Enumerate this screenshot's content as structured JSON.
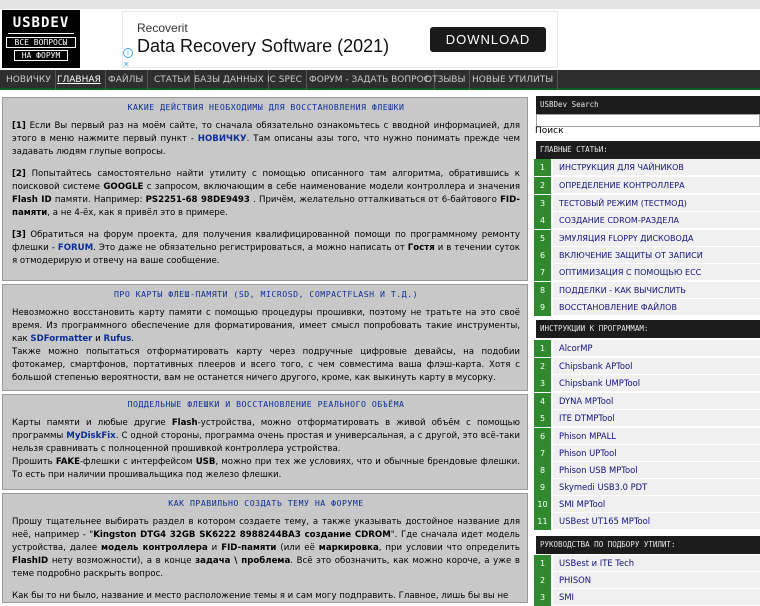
{
  "logo": {
    "line1": "USBDEV",
    "line2": "ВСЕ ВОПРОСЫ",
    "line3": "НА ФОРУМ"
  },
  "ad": {
    "brand": "Recoverit",
    "headline": "Data Recovery Software (2021)",
    "button": "DOWNLOAD",
    "info_icon": "info-icon",
    "close_icon": "close-icon"
  },
  "nav": [
    "НОВИЧКУ",
    "ГЛАВНАЯ",
    "ФАЙЛЫ",
    "СТАТЬИ",
    "БАЗЫ ДАННЫХ",
    "IC SPEC",
    "ФОРУМ - ЗАДАТЬ ВОПРОС",
    "ОТЗЫВЫ",
    "НОВЫЕ УТИЛИТЫ"
  ],
  "sections": [
    {
      "title": "КАКИЕ ДЕЙСТВИЯ НЕОБХОДИМЫ ДЛЯ ВОССТАНОВЛЕНИЯ ФЛЕШКИ",
      "p1a": "[1]",
      "p1b": " Если Вы первый раз на моём сайте, то сначала обязательно ознакомьтесь с вводной информацией, для этого в меню нажмите первый пункт - ",
      "p1c": "НОВИЧКУ",
      "p1d": ". Там описаны азы того, что нужно понимать прежде чем задавать людям глупые вопросы.",
      "p2a": "[2]",
      "p2b": " Попытайтесь самостоятельно найти утилиту с помощью описанного там алгоритма, обратившись к поисковой системе ",
      "p2c": "GOOGLE",
      "p2d": " с запросом, включающим в себе наименование модели контроллера и значения ",
      "p2e": "Flash ID",
      "p2f": " памяти. Например: ",
      "p2g": "PS2251-68 98DE9493",
      "p2h": " . Причём, желательно отталкиваться от 6-байтового ",
      "p2i": "FID-памяти",
      "p2j": ", а не 4-ёх, как я привёл это в примере.",
      "p3a": "[3]",
      "p3b": " Обратиться на форум проекта, для получения квалифицированной помощи по программному ремонту флешки - ",
      "p3c": "FORUM",
      "p3d": ". Это даже не обязательно регистрироваться, а можно написать от ",
      "p3e": "Гостя",
      "p3f": " и в течении суток я отмодерирую и отвечу на ваше сообщение."
    },
    {
      "title": "ПРО КАРТЫ ФЛЕШ-ПАМЯТИ (SD, microSD, CompactFlash и т.д.)",
      "p1a": "Невозможно восстановить карту памяти с помощью процедуры прошивки, поэтому не тратьте на это своё время. Из программного обеспечение для форматирования, имеет смысл попробовать такие инструменты, как ",
      "p1b": "SDFormatter",
      "p1c": " и ",
      "p1d": "Rufus",
      "p1e": ".",
      "p2": "Также можно попытаться отформатировать карту через подручные цифровые девайсы, на подобии фотокамер, смартфонов, портативных плееров и всего того, с чем совместима ваша флэш-карта. Хотя с большой степенью вероятности, вам не останется ничего другого, кроме, как выкинуть карту в мусорку."
    },
    {
      "title": "ПОДДЕЛЬНЫЕ ФЛЕШКИ И ВОССТАНОВЛЕНИЕ РЕАЛЬНОГО ОБЪЁМА",
      "p1a": "Карты памяти и любые другие ",
      "p1b": "Flash",
      "p1c": "-устройства, можно отформатировать в живой объём с помощью программы ",
      "p1d": "MyDiskFix",
      "p1e": ". С одной стороны, программа очень простая и универсальная, а с другой, это всё-таки нельзя сравнивать с полноценной прошивкой контроллера устройства.",
      "p2a": "Прошить ",
      "p2b": "FAKE",
      "p2c": "-флешки с интерфейсом ",
      "p2d": "USB",
      "p2e": ", можно при тех же условиях, что и обычные брендовые флешки. То есть при наличии прошивальщика под железо флешки."
    },
    {
      "title": "КАК ПРАВИЛЬНО СОЗДАТЬ ТЕМУ НА ФОРУМЕ",
      "p1a": "Прошу тщательнее выбирать раздел в котором создаете тему, а также указывать достойное название для неё, например - \"",
      "p1b": "Kingston DTG4 32GB SK6222 8988244BA3 создание CDROM",
      "p1c": "\". Где сначала идет модель устройства, далее ",
      "p1d": "модель контроллера",
      "p1e": " и ",
      "p1f": "FID-памяти",
      "p1g": " (или её ",
      "p1h": "маркировка",
      "p1i": ", при условии что определить ",
      "p1j": "FlashID",
      "p1k": " нету возможности), а в конце ",
      "p1l": "задача \\ проблема",
      "p1m": ". Всё это обозначить, как можно короче, а уже в теме подробно раскрыть вопрос.",
      "p2": "Как бы то ни было, название и место расположение темы я и сам могу подправить. Главное, лишь бы вы не"
    }
  ],
  "sidebar": {
    "search_title": "USBDev Search",
    "search_label": "Поиск",
    "main_articles_title": "ГЛАВНЫЕ СТАТЬИ:",
    "main_articles": [
      "ИНСТРУКЦИЯ ДЛЯ ЧАЙНИКОВ",
      "ОПРЕДЕЛЕНИЕ КОНТРОЛЛЕРА",
      "ТЕСТОВЫЙ РЕЖИМ (ТЕСТМОД)",
      "СОЗДАНИЕ CDROM-РАЗДЕЛА",
      "ЭМУЛЯЦИЯ FLOPPY ДИСКОВОДА",
      "ВКЛЮЧЕНИЕ ЗАЩИТЫ ОТ ЗАПИСИ",
      "ОПТИМИЗАЦИЯ С ПОМОЩЬЮ ECC",
      "ПОДДЕЛКИ - КАК ВЫЧИСЛИТЬ",
      "ВОССТАНОВЛЕНИЕ ФАЙЛОВ"
    ],
    "instructions_title": "ИНСТРУКЦИИ К ПРОГРАММАМ:",
    "instructions": [
      "AlcorMP",
      "Chipsbank APTool",
      "Chipsbank UMPTool",
      "DYNA MPTool",
      "ITE DTMPTool",
      "Phison MPALL",
      "Phison UPTool",
      "Phison USB MPTool",
      "Skymedi USB3.0 PDT",
      "SMI MPTool",
      "USBest UT165 MPTool"
    ],
    "guides_title": "РУКОВОДСТВА ПО ПОДБОРУ УТИЛИТ:",
    "guides": [
      "USBest и ITE Tech",
      "PHISON",
      "SMI"
    ]
  }
}
